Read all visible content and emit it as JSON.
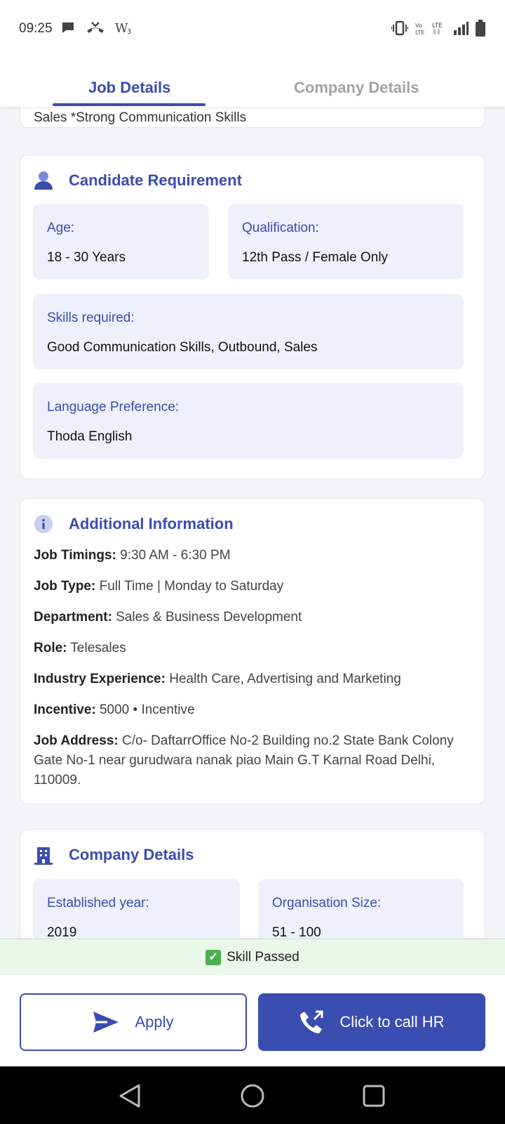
{
  "status_bar": {
    "time": "09:25",
    "left_icons": [
      "chat-icon",
      "missed-call-icon",
      "wifi-calling-icon"
    ],
    "right_icons": [
      "vibrate-icon",
      "volte-icon",
      "lte-icon",
      "signal-icon",
      "battery-icon"
    ]
  },
  "tabs": [
    {
      "label": "Job Details",
      "active": true
    },
    {
      "label": "Company Details",
      "active": false
    }
  ],
  "top_card": {
    "partial_text": "Sales *Strong Communication Skills"
  },
  "candidate": {
    "title": "Candidate Requirement",
    "age_label": "Age:",
    "age_value": "18 - 30 Years",
    "qualification_label": "Qualification:",
    "qualification_value": "12th Pass / Female Only",
    "skills_label": "Skills required:",
    "skills_value": "Good Communication Skills, Outbound, Sales",
    "language_label": "Language Preference:",
    "language_value": "Thoda English"
  },
  "additional": {
    "title": "Additional Information",
    "items": [
      {
        "label": "Job Timings:",
        "value": " 9:30 AM - 6:30 PM"
      },
      {
        "label": "Job Type:",
        "value": " Full Time | Monday to Saturday"
      },
      {
        "label": "Department:",
        "value": " Sales & Business Development"
      },
      {
        "label": "Role:",
        "value": " Telesales"
      },
      {
        "label": "Industry Experience:",
        "value": " Health Care, Advertising and Marketing"
      },
      {
        "label": "Incentive:",
        "value": " 5000 • Incentive"
      },
      {
        "label": "Job Address:",
        "value": " C/o- DaftarrOffice No-2 Building no.2 State Bank Colony Gate No-1 near gurudwara nanak piao Main G.T Karnal Road Delhi, 110009."
      }
    ]
  },
  "company": {
    "title": "Company Details",
    "established_label": "Established year:",
    "established_value": "2019",
    "size_label": "Organisation Size:",
    "size_value": "51 - 100"
  },
  "skill_status": "Skill Passed",
  "buttons": {
    "apply": "Apply",
    "call": "Click to call HR"
  },
  "colors": {
    "accent": "#3a4db0",
    "label_blue": "#3a4db0",
    "box_bg": "#eef1fb",
    "skill_bg": "#eaf8ea"
  }
}
